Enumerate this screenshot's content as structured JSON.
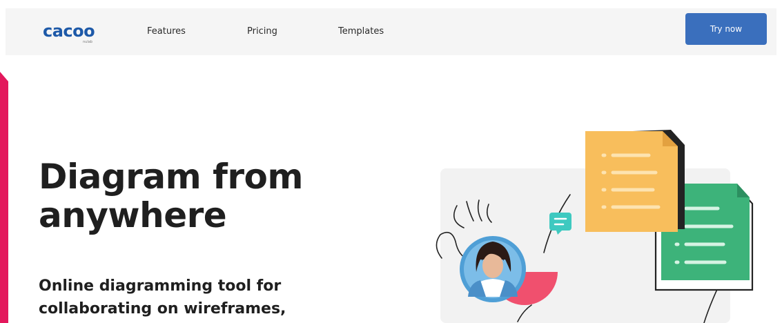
{
  "header": {
    "logo": {
      "wordmark": "cacoo",
      "sub": "nulab"
    },
    "nav": [
      {
        "label": "Features"
      },
      {
        "label": "Pricing"
      },
      {
        "label": "Templates"
      }
    ],
    "cta_label": "Try now"
  },
  "hero": {
    "title_line1": "Diagram from",
    "title_line2": "anywhere",
    "subtitle_line1": "Online diagramming tool for",
    "subtitle_line2": "collaborating on wireframes,"
  },
  "colors": {
    "brand_blue": "#1d59a8",
    "cta_blue": "#3a6fbd",
    "accent_magenta": "#e3185c",
    "doc_yellow": "#f8be5c",
    "doc_green": "#3db37a",
    "chat_teal": "#3ec9c0",
    "pink_arc": "#f0506e"
  },
  "icons": [
    "chat-bubble-icon",
    "avatar",
    "document-icon"
  ]
}
